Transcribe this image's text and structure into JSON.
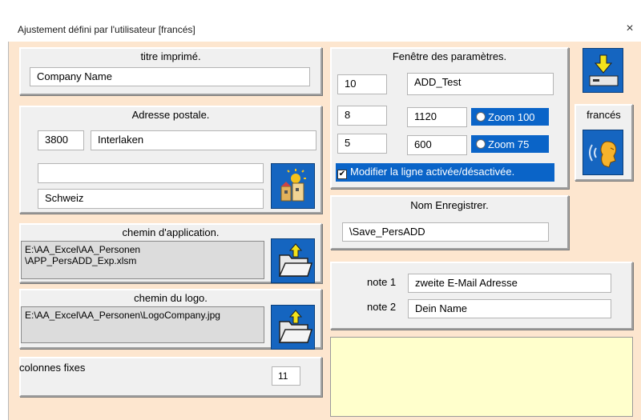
{
  "window": {
    "title": "Ajustement défini par l'utilisateur  [francés]",
    "close_label": "×"
  },
  "titre": {
    "heading": "titre imprimé.",
    "value": "Company Name"
  },
  "adresse": {
    "heading": "Adresse postale.",
    "zip": "3800",
    "city": "Interlaken",
    "line": "",
    "country": "Schweiz"
  },
  "chemin_app": {
    "heading": "chemin d'application.",
    "value": "E:\\AA_Excel\\AA_Personen\n\\APP_PersADD_Exp.xlsm"
  },
  "chemin_logo": {
    "heading": "chemin du logo.",
    "value": "E:\\AA_Excel\\AA_Personen\\LogoCompany.jpg"
  },
  "colonnes": {
    "label": "colonnes fixes",
    "value": "11"
  },
  "parametres": {
    "heading": "Fenêtre des paramètres.",
    "row1_num": "10",
    "row1_name": "ADD_Test",
    "row2_num": "8",
    "row2_val": "1120",
    "zoom100": "Zoom 100",
    "row3_num": "5",
    "row3_val": "600",
    "zoom75": "Zoom 75",
    "toggle_label": "Modifier la ligne activée/désactivée.",
    "toggle_mark": "✔"
  },
  "nom_enregistrer": {
    "heading": "Nom Enregistrer.",
    "value": "\\Save_PersADD"
  },
  "notes": {
    "note1_label": "note 1",
    "note1_value": "zweite E-Mail Adresse",
    "note2_label": "note 2",
    "note2_value": "Dein Name"
  },
  "langue": {
    "label": "francés"
  }
}
